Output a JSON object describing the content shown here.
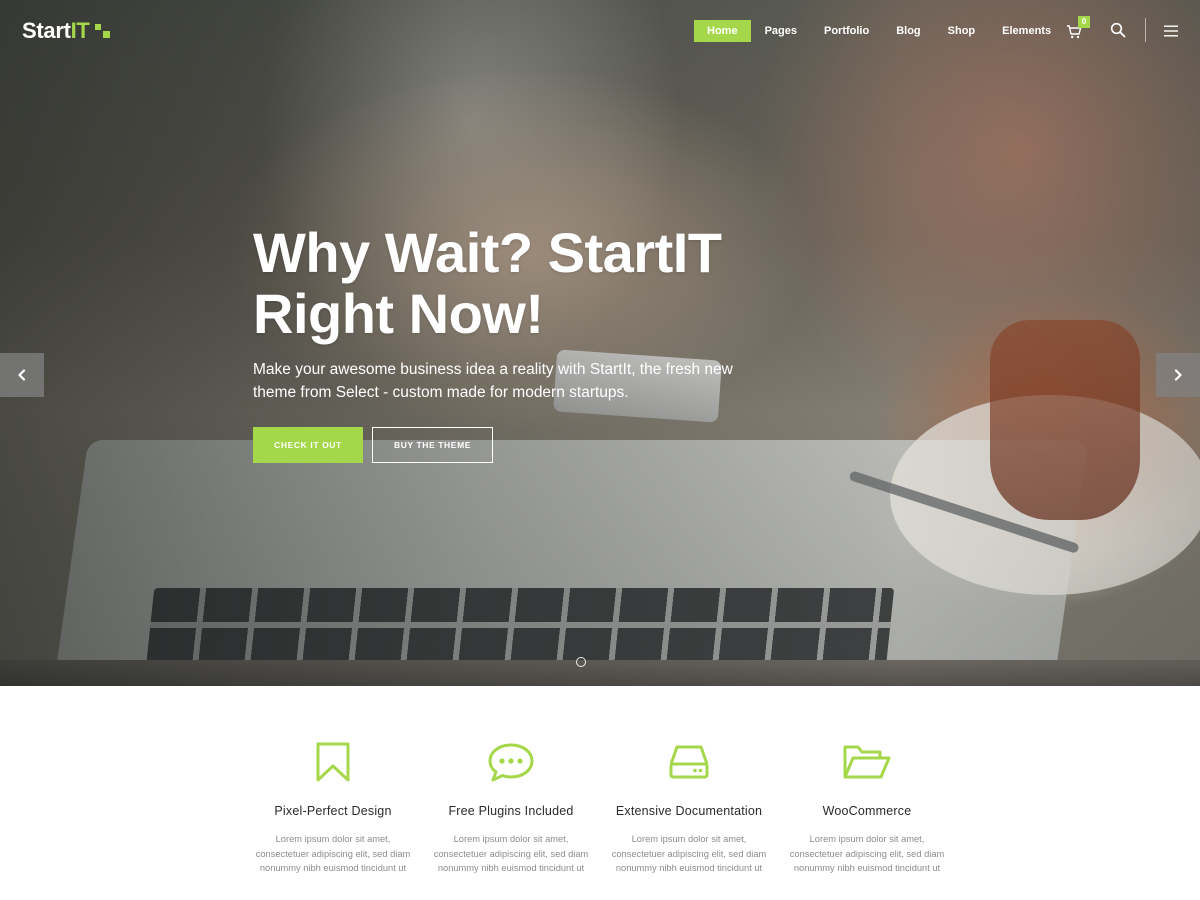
{
  "header": {
    "logo_text": "Start",
    "logo_accent": "IT",
    "nav": [
      {
        "label": "Home",
        "active": true
      },
      {
        "label": "Pages",
        "active": false
      },
      {
        "label": "Portfolio",
        "active": false
      },
      {
        "label": "Blog",
        "active": false
      },
      {
        "label": "Shop",
        "active": false
      },
      {
        "label": "Elements",
        "active": false
      }
    ],
    "cart_count": "0",
    "icons": [
      "cart-icon",
      "search-icon",
      "hamburger-menu-icon"
    ]
  },
  "hero": {
    "title_line1": "Why Wait? StartIT",
    "title_line2": "Right Now!",
    "subtitle_line1": "Make your awesome business idea a reality with StartIt, the fresh new",
    "subtitle_line2": "theme from Select - custom made for modern startups.",
    "primary_button": "CHECK IT OUT",
    "secondary_button": "BUY THE THEME",
    "prev_icon": "chevron-left-icon",
    "next_icon": "chevron-right-icon"
  },
  "features": [
    {
      "icon": "bookmark-icon",
      "title": "Pixel-Perfect Design",
      "desc_line1": "Lorem ipsum dolor sit amet,",
      "desc_line2": "consectetuer adipiscing elit, sed diam",
      "desc_line3": "nonummy nibh euismod tincidunt ut"
    },
    {
      "icon": "chat-bubble-icon",
      "title": "Free Plugins Included",
      "desc_line1": "Lorem ipsum dolor sit amet,",
      "desc_line2": "consectetuer adipiscing elit, sed diam",
      "desc_line3": "nonummy nibh euismod tincidunt ut"
    },
    {
      "icon": "hard-drive-icon",
      "title": "Extensive Documentation",
      "desc_line1": "Lorem ipsum dolor sit amet,",
      "desc_line2": "consectetuer adipiscing elit, sed diam",
      "desc_line3": "nonummy nibh euismod tincidunt ut"
    },
    {
      "icon": "folder-open-icon",
      "title": "WooCommerce",
      "desc_line1": "Lorem ipsum dolor sit amet,",
      "desc_line2": "consectetuer adipiscing elit, sed diam",
      "desc_line3": "nonummy nibh euismod tincidunt ut"
    }
  ],
  "colors": {
    "accent": "#a4d84a",
    "heading_text": "#2b2b2b",
    "body_text": "#8c8c8c"
  }
}
